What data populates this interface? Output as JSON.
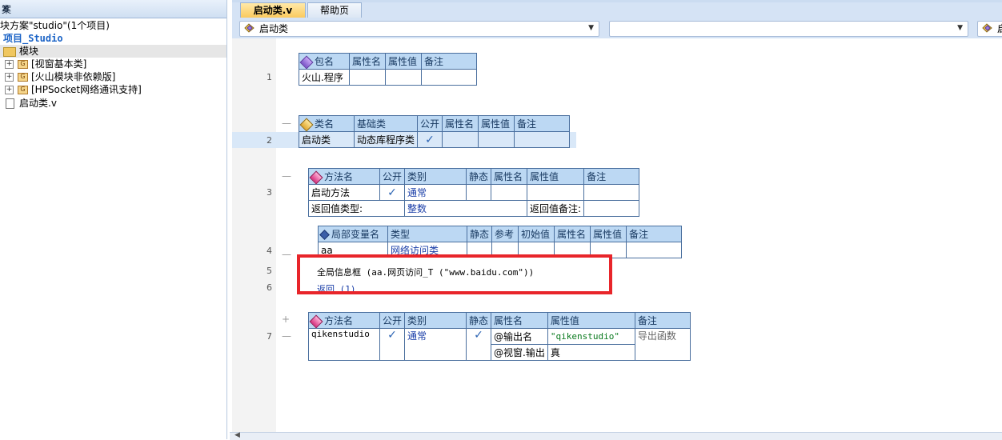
{
  "left_panel": {
    "title": "案",
    "pin_icon": "pin-icon",
    "close_icon": "close-icon",
    "solution_line": "块方案\"studio\"(1个项目)",
    "project": "项目_Studio",
    "modules_folder": "模块",
    "modules": [
      "[视窗基本类]",
      "[火山模块非依赖版]",
      "[HPSocket网络通讯支持]"
    ],
    "file": "启动类.v"
  },
  "tabs": [
    {
      "label": "启动类.v",
      "active": true
    },
    {
      "label": "帮助页",
      "active": false
    }
  ],
  "toolbar": {
    "class_combo": "启动类",
    "method_combo": "",
    "right_combo": "启"
  },
  "line_numbers": [
    "1",
    "2",
    "3",
    "4",
    "5",
    "6",
    "7"
  ],
  "package_table": {
    "headers": [
      "包名",
      "属性名",
      "属性值",
      "备注"
    ],
    "row": [
      "火山.程序",
      "",
      "",
      ""
    ]
  },
  "class_table": {
    "headers": [
      "类名",
      "基础类",
      "公开",
      "属性名",
      "属性值",
      "备注"
    ],
    "row": [
      "启动类",
      "动态库程序类",
      "✓",
      "",
      "",
      ""
    ]
  },
  "method_table1": {
    "headers": [
      "方法名",
      "公开",
      "类别",
      "静态",
      "属性名",
      "属性值",
      "备注"
    ],
    "row": [
      "启动方法",
      "✓",
      "通常",
      "",
      "",
      "",
      ""
    ],
    "return_label": "返回值类型:",
    "return_value": "整数",
    "return_note_label": "返回值备注:"
  },
  "local_var_table": {
    "headers": [
      "局部变量名",
      "类型",
      "静态",
      "参考",
      "初始值",
      "属性名",
      "属性值",
      "备注"
    ],
    "row": [
      "aa",
      "网络访问类",
      "",
      "",
      "",
      "",
      "",
      ""
    ]
  },
  "code_lines": [
    "全局信息框 (aa.网页访问_T (\"www.baidu.com\"))",
    "返回 (1)"
  ],
  "method_table2": {
    "headers": [
      "方法名",
      "公开",
      "类别",
      "静态",
      "属性名",
      "属性值",
      "备注"
    ],
    "row1": [
      "qikenstudio",
      "✓",
      "通常",
      "✓",
      "@输出名",
      "\"qikenstudio\"",
      "导出函数"
    ],
    "row2": [
      "@视窗.输出",
      "真"
    ]
  },
  "colors": {
    "highlight_box": "#e8252a",
    "table_header": "#bcd8f3",
    "active_tab": "#fac85a"
  }
}
